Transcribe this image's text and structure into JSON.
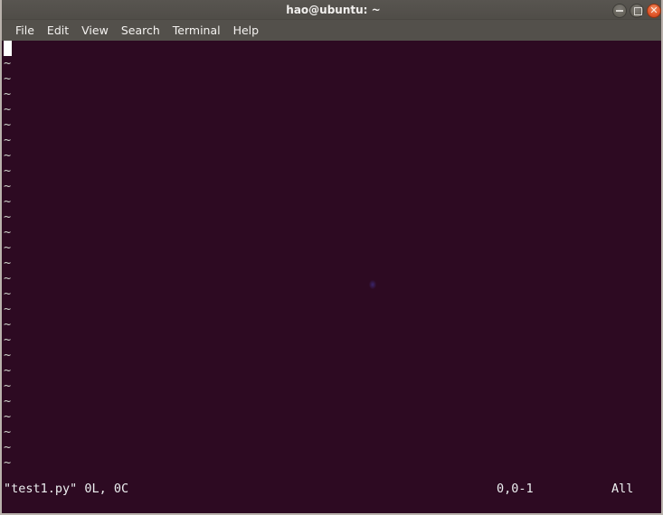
{
  "window": {
    "title": "hao@ubuntu: ~",
    "controls": [
      {
        "name": "minimize",
        "label": "–"
      },
      {
        "name": "maximize",
        "label": "□"
      },
      {
        "name": "close",
        "label": "✕"
      }
    ],
    "colors": {
      "titlebar": "#53504b",
      "menubar": "#53504b",
      "terminal_bg": "#2d0a22",
      "terminal_fg": "#d3d7cf",
      "close_button": "#e2562a",
      "cursor": "#ffffff",
      "frame": "#b9b2ac"
    }
  },
  "menubar": {
    "items": [
      {
        "label": "File"
      },
      {
        "label": "Edit"
      },
      {
        "label": "View"
      },
      {
        "label": "Search"
      },
      {
        "label": "Terminal"
      },
      {
        "label": "Help"
      }
    ]
  },
  "terminal": {
    "application": "vim",
    "cursor": {
      "row": 1,
      "column": 1,
      "shape": "block"
    },
    "empty_line_marker": "~",
    "empty_line_count": 27,
    "lines": [
      "",
      "~",
      "~",
      "~",
      "~",
      "~",
      "~",
      "~",
      "~",
      "~",
      "~",
      "~",
      "~",
      "~",
      "~",
      "~",
      "~",
      "~",
      "~",
      "~",
      "~",
      "~",
      "~",
      "~",
      "~",
      "~",
      "~",
      "~"
    ]
  },
  "statusline": {
    "file": "\"test1.py\" 0L, 0C",
    "position": "0,0-1",
    "scroll": "All"
  }
}
